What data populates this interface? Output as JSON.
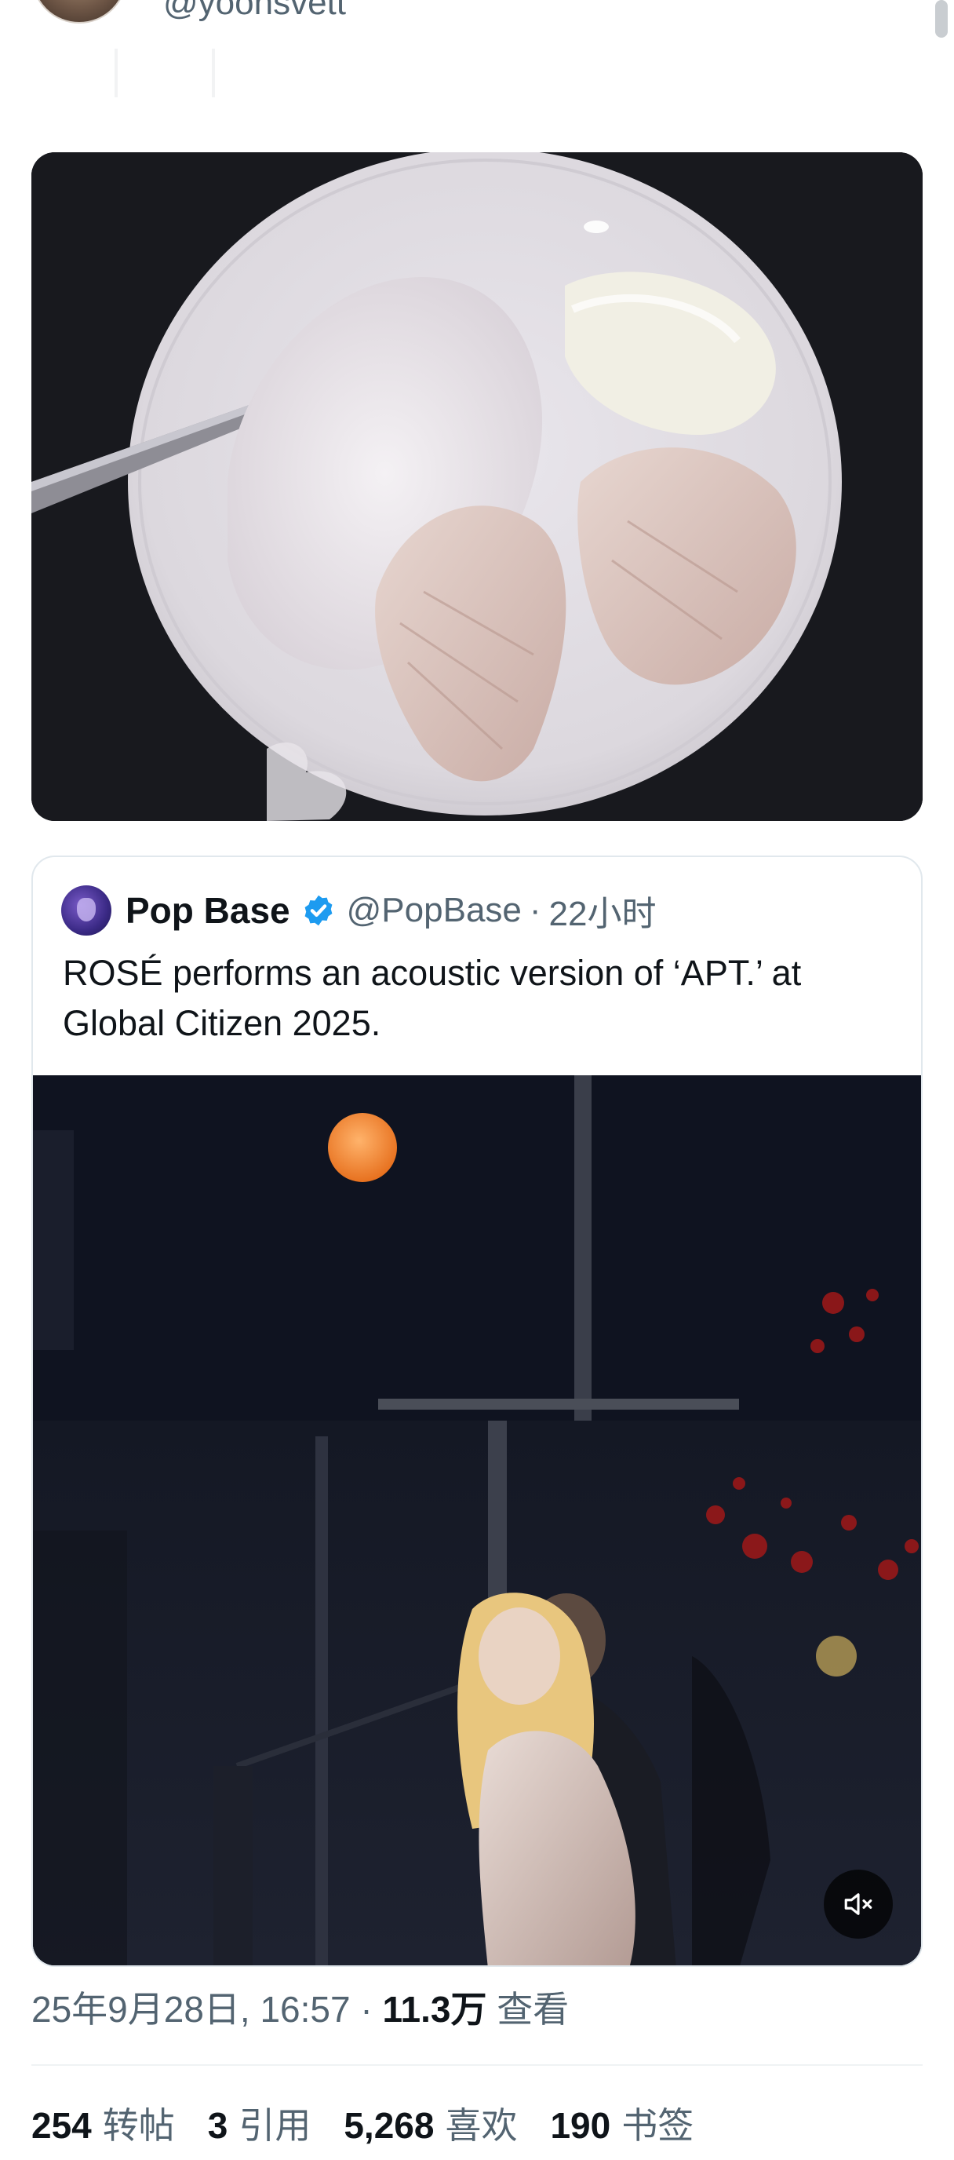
{
  "author": {
    "handle": "@yoonsvett"
  },
  "quoted_tweet": {
    "name": "Pop Base",
    "handle": "@PopBase",
    "separator": "·",
    "time": "22小时",
    "text": "ROSÉ performs an acoustic version of ‘APT.’ at Global Citizen 2025."
  },
  "meta": {
    "date": "25年9月28日, 16:57",
    "separator": "·",
    "views": "11.3万",
    "views_label": "查看"
  },
  "stats": [
    {
      "num": "254",
      "label": "转帖"
    },
    {
      "num": "3",
      "label": "引用"
    },
    {
      "num": "5,268",
      "label": "喜欢"
    },
    {
      "num": "190",
      "label": "书签"
    }
  ],
  "icons": {
    "verified": "verified-badge-icon",
    "mute": "muted-speaker-icon"
  },
  "colors": {
    "verified": "#1d9bf0",
    "secondary_text": "#536471"
  }
}
